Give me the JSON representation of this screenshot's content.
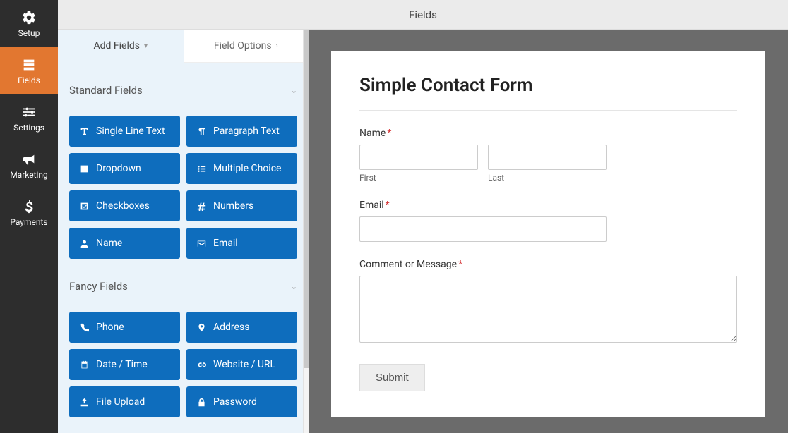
{
  "vnav": {
    "items": [
      {
        "label": "Setup",
        "icon": "gear"
      },
      {
        "label": "Fields",
        "icon": "form"
      },
      {
        "label": "Settings",
        "icon": "sliders"
      },
      {
        "label": "Marketing",
        "icon": "bullhorn"
      },
      {
        "label": "Payments",
        "icon": "dollar"
      }
    ],
    "active_index": 1
  },
  "toolbar": {
    "title": "Fields"
  },
  "panel": {
    "tabs": {
      "add": "Add Fields",
      "options": "Field Options"
    },
    "sections": {
      "standard": {
        "title": "Standard Fields"
      },
      "fancy": {
        "title": "Fancy Fields"
      }
    },
    "standard_fields": [
      {
        "label": "Single Line Text",
        "icon": "text-input"
      },
      {
        "label": "Paragraph Text",
        "icon": "paragraph"
      },
      {
        "label": "Dropdown",
        "icon": "caret-square"
      },
      {
        "label": "Multiple Choice",
        "icon": "list-dots"
      },
      {
        "label": "Checkboxes",
        "icon": "check-square"
      },
      {
        "label": "Numbers",
        "icon": "hash"
      },
      {
        "label": "Name",
        "icon": "user"
      },
      {
        "label": "Email",
        "icon": "envelope"
      }
    ],
    "fancy_fields": [
      {
        "label": "Phone",
        "icon": "phone"
      },
      {
        "label": "Address",
        "icon": "map-pin"
      },
      {
        "label": "Date / Time",
        "icon": "calendar"
      },
      {
        "label": "Website / URL",
        "icon": "link"
      },
      {
        "label": "File Upload",
        "icon": "upload"
      },
      {
        "label": "Password",
        "icon": "lock"
      }
    ]
  },
  "preview": {
    "form_title": "Simple Contact Form",
    "name": {
      "label": "Name",
      "first_sublabel": "First",
      "last_sublabel": "Last"
    },
    "email": {
      "label": "Email"
    },
    "message": {
      "label": "Comment or Message"
    },
    "submit_label": "Submit",
    "required_marker": "*"
  },
  "colors": {
    "accent_orange": "#e27730",
    "field_button_blue": "#0e6dbd"
  }
}
